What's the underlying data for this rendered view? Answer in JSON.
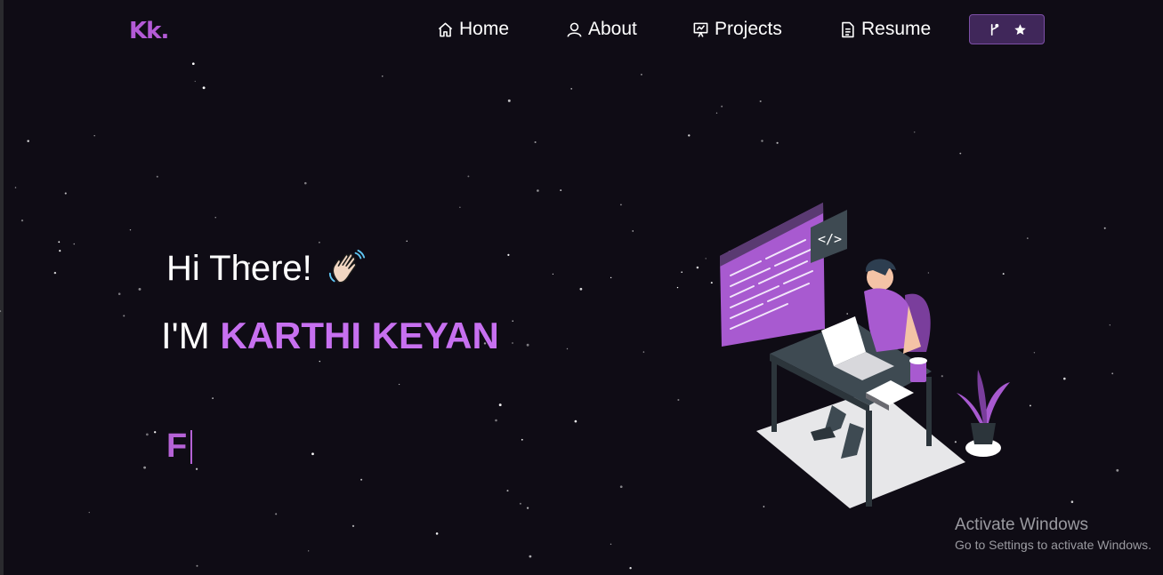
{
  "nav": {
    "logo": "Kk.",
    "items": [
      {
        "label": "Home",
        "icon": "home-icon"
      },
      {
        "label": "About",
        "icon": "user-icon"
      },
      {
        "label": "Projects",
        "icon": "presentation-icon"
      },
      {
        "label": "Resume",
        "icon": "document-icon"
      }
    ],
    "fork_button": {
      "icons": [
        "git-fork-icon",
        "star-icon"
      ]
    }
  },
  "hero": {
    "greeting": "Hi There!",
    "wave_icon": "waving-hand-icon",
    "intro_prefix": "I'M",
    "name": "KARTHI KEYAN",
    "typewriter_text": "F"
  },
  "illustration": {
    "icon": "developer-at-desk-illustration"
  },
  "windows_watermark": {
    "title": "Activate Windows",
    "subtitle": "Go to Settings to activate Windows."
  },
  "colors": {
    "background": "#0f0c15",
    "accent": "#c770f0",
    "accent_dark": "#b562d6",
    "button_bg": "#40275a"
  }
}
